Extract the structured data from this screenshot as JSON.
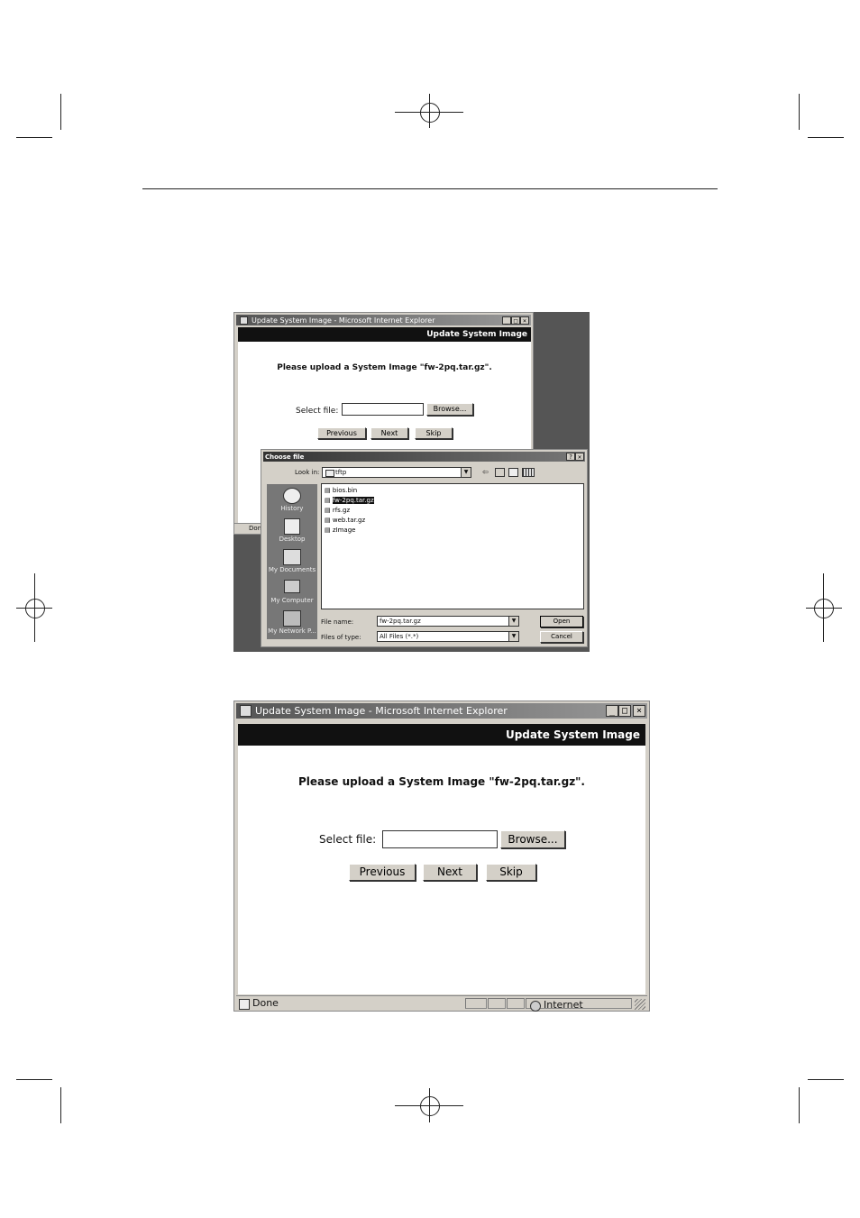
{
  "top_screenshot": {
    "window_title": "Update System Image - Microsoft Internet Explorer",
    "header": "Update System Image",
    "message": "Please upload a System Image \"fw-2pq.tar.gz\".",
    "select_label": "Select file:",
    "browse_label": "Browse...",
    "buttons": {
      "previous": "Previous",
      "next": "Next",
      "skip": "Skip"
    },
    "status_text": "Don",
    "dialog": {
      "title": "Choose file",
      "help": "?",
      "close": "✕",
      "look_in_label": "Look in:",
      "look_in_value": "tftp",
      "places": [
        {
          "label": "History",
          "icon": "history-icon"
        },
        {
          "label": "Desktop",
          "icon": "desktop-icon"
        },
        {
          "label": "My Documents",
          "icon": "my-documents-icon"
        },
        {
          "label": "My Computer",
          "icon": "my-computer-icon"
        },
        {
          "label": "My Network P...",
          "icon": "my-network-icon"
        }
      ],
      "files": [
        "bios.bin",
        "fw-2pq.tar.gz",
        "rfs.gz",
        "web.tar.gz",
        "zImage"
      ],
      "selected_file": "fw-2pq.tar.gz",
      "file_name_label": "File name:",
      "file_name_value": "fw-2pq.tar.gz",
      "file_type_label": "Files of type:",
      "file_type_value": "All Files (*.*)",
      "open_label": "Open",
      "cancel_label": "Cancel"
    }
  },
  "bottom_screenshot": {
    "window_title": "Update System Image - Microsoft Internet Explorer",
    "header": "Update System Image",
    "message": "Please upload a System Image \"fw-2pq.tar.gz\".",
    "select_label": "Select file:",
    "browse_label": "Browse...",
    "buttons": {
      "previous": "Previous",
      "next": "Next",
      "skip": "Skip"
    },
    "status_text": "Done",
    "zone_text": "Internet"
  }
}
